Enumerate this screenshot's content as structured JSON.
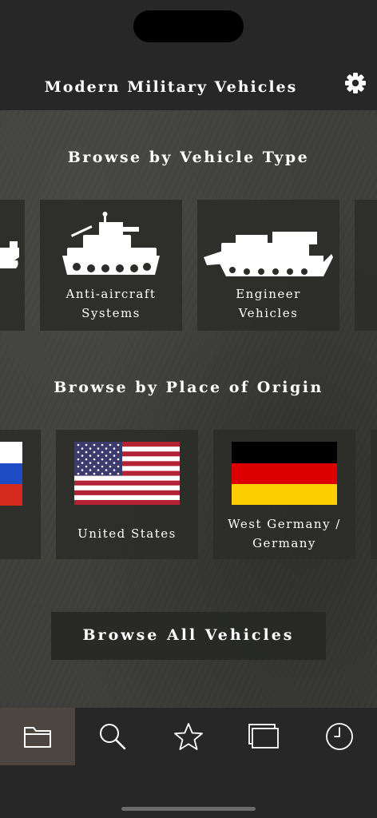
{
  "header": {
    "title": "Modern Military Vehicles"
  },
  "vehicle_types": {
    "title": "Browse by Vehicle Type",
    "items": [
      {
        "label_line1": "Anti-aircraft",
        "label_line2": "Systems"
      },
      {
        "label_line1": "Engineer",
        "label_line2": "Vehicles"
      }
    ]
  },
  "origins": {
    "title": "Browse by Place of Origin",
    "items": [
      {
        "label_line1": "United States"
      },
      {
        "label_line1": "West Germany /",
        "label_line2": "Germany"
      }
    ]
  },
  "browse_all": {
    "label": "Browse All Vehicles"
  },
  "tabbar": {
    "active_tab": "browse",
    "tabs": [
      {
        "icon": "folder-icon"
      },
      {
        "icon": "search-icon"
      },
      {
        "icon": "star-icon"
      },
      {
        "icon": "cards-icon"
      },
      {
        "icon": "clock-icon"
      }
    ]
  },
  "colors": {
    "active_tab_bg": "#4d453f",
    "background": "#272727"
  }
}
